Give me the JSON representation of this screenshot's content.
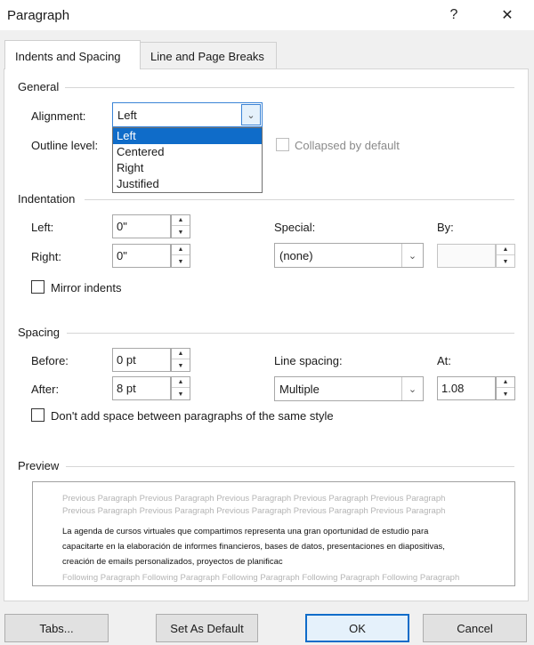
{
  "window": {
    "title": "Paragraph",
    "help_glyph": "?",
    "close_glyph": "✕"
  },
  "tabs": [
    {
      "label": "Indents and Spacing",
      "active": true
    },
    {
      "label": "Line and Page Breaks",
      "active": false
    }
  ],
  "general": {
    "heading": "General",
    "alignment_label": "Alignment:",
    "alignment_value": "Left",
    "alignment_options": [
      "Left",
      "Centered",
      "Right",
      "Justified"
    ],
    "outline_label": "Outline level:",
    "collapsed_label": "Collapsed by default"
  },
  "indentation": {
    "heading": "Indentation",
    "left_label": "Left:",
    "left_value": "0\"",
    "right_label": "Right:",
    "right_value": "0\"",
    "special_label": "Special:",
    "special_value": "(none)",
    "by_label": "By:",
    "by_value": "",
    "mirror_label": "Mirror indents"
  },
  "spacing": {
    "heading": "Spacing",
    "before_label": "Before:",
    "before_value": "0 pt",
    "after_label": "After:",
    "after_value": "8 pt",
    "line_spacing_label": "Line spacing:",
    "line_spacing_value": "Multiple",
    "at_label": "At:",
    "at_value": "1.08",
    "dont_add_label": "Don't add space between paragraphs of the same style"
  },
  "preview": {
    "heading": "Preview",
    "previous_1": "Previous Paragraph Previous Paragraph Previous Paragraph Previous Paragraph Previous Paragraph",
    "previous_2": "Previous Paragraph Previous Paragraph Previous Paragraph Previous Paragraph Previous Paragraph",
    "body_1": "La agenda de cursos virtuales que compartimos representa una gran oportunidad de estudio para",
    "body_2": "capacitarte en la elaboración de informes financieros, bases de datos, presentaciones en diapositivas,",
    "body_3": "creación de emails personalizados, proyectos de planificac",
    "following": "Following Paragraph Following Paragraph Following Paragraph Following Paragraph Following Paragraph"
  },
  "buttons": {
    "tabs": "Tabs...",
    "set_default": "Set As Default",
    "ok": "OK",
    "cancel": "Cancel"
  },
  "colors": {
    "accent": "#0f6cc9",
    "dialog_bg": "#f0f0f0"
  }
}
